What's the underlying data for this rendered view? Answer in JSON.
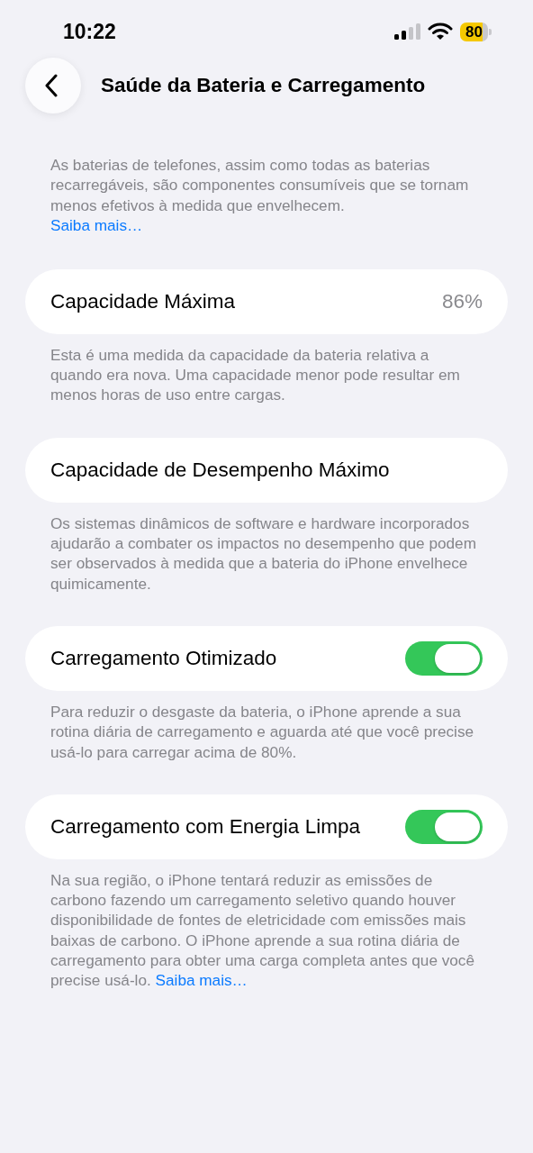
{
  "status_bar": {
    "time": "10:22",
    "battery": "80"
  },
  "nav": {
    "title": "Saúde da Bateria e Carregamento"
  },
  "intro": {
    "text": "As baterias de telefones, assim como todas as baterias recarregáveis, são componentes consumíveis que se tornam menos efetivos à medida que envelhecem.",
    "link": "Saiba mais…"
  },
  "sections": [
    {
      "kind": "value",
      "label": "Capacidade Máxima",
      "value": "86%",
      "footer": "Esta é uma medida da capacidade da bateria relativa a quando era nova. Uma capacidade menor pode resultar em menos horas de uso entre cargas."
    },
    {
      "kind": "plain",
      "label": "Capacidade de Desempenho Máximo",
      "footer": "Os sistemas dinâmicos de software e hardware incorporados ajudarão a combater os impactos no desempenho que podem ser observados à medida que a bateria do iPhone envelhece quimicamente."
    },
    {
      "kind": "toggle",
      "label": "Carregamento Otimizado",
      "on": true,
      "footer": "Para reduzir o desgaste da bateria, o iPhone aprende a sua rotina diária de carregamento e aguarda até que você precise usá-lo para carregar acima de 80%."
    },
    {
      "kind": "toggle",
      "label": "Carregamento com Energia Limpa",
      "on": true,
      "footer": "Na sua região, o iPhone tentará reduzir as emissões de carbono fazendo um carregamento seletivo quando houver disponibilidade de fontes de eletricidade com emissões mais baixas de carbono. O iPhone aprende a sua rotina diária de carregamento para obter uma carga completa antes que você precise usá-lo.",
      "link": "Saiba mais…"
    }
  ]
}
